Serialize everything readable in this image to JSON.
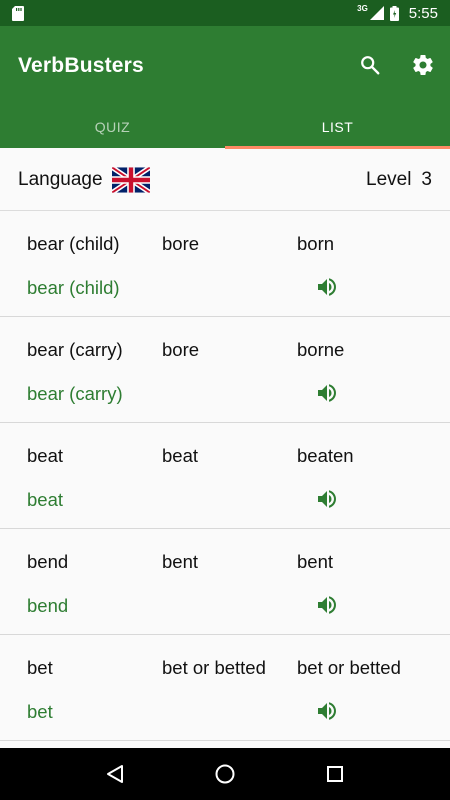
{
  "status_bar": {
    "network": "3G",
    "time": "5:55",
    "icons": [
      "sd-card-icon",
      "signal-icon",
      "battery-icon"
    ]
  },
  "app_bar": {
    "title": "VerbBusters",
    "actions": [
      "search-icon",
      "settings-icon"
    ]
  },
  "tabs": [
    {
      "label": "QUIZ",
      "selected": false
    },
    {
      "label": "LIST",
      "selected": true
    }
  ],
  "header": {
    "language_label": "Language",
    "language_flag": "uk-flag-icon",
    "level_label": "Level",
    "level_value": "3"
  },
  "verbs": [
    {
      "base": "bear (child)",
      "past": "bore",
      "participle": "born",
      "translation": "bear (child)"
    },
    {
      "base": "bear (carry)",
      "past": "bore",
      "participle": "borne",
      "translation": "bear (carry)"
    },
    {
      "base": "beat",
      "past": "beat",
      "participle": "beaten",
      "translation": "beat"
    },
    {
      "base": "bend",
      "past": "bent",
      "participle": "bent",
      "translation": "bend"
    },
    {
      "base": "bet",
      "past": "bet or betted",
      "participle": "bet or betted",
      "translation": "bet"
    }
  ],
  "colors": {
    "status_bar": "#1b5e20",
    "app_bar": "#2e7d32",
    "accent_indicator": "#ff8a65",
    "translation_text": "#2e7d32"
  },
  "nav": [
    "back-icon",
    "home-icon",
    "recents-icon"
  ]
}
